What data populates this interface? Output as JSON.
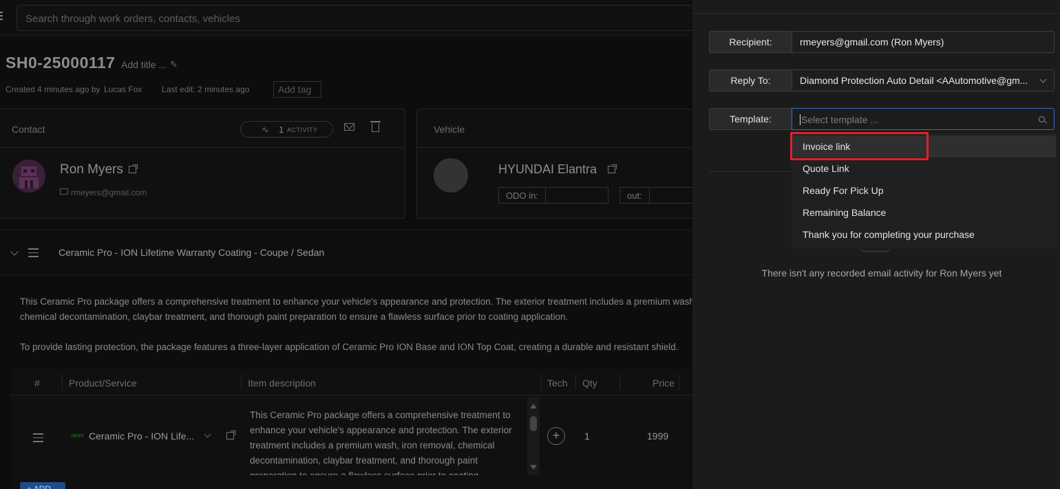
{
  "header": {
    "search_placeholder": "Search through work orders, contacts, vehicles"
  },
  "work_order": {
    "number": "SH0-25000117",
    "add_title": "Add title ...",
    "created": "Created 4 minutes ago by",
    "created_by": "Lucas Fox",
    "last_edit": "Last edit: 2 minutes ago",
    "add_tag": "Add tag"
  },
  "contact_card": {
    "title": "Contact",
    "activity_count": "1",
    "activity_label": "ACTIVITY",
    "name": "Ron Myers",
    "email": "rmeyers@gmail.com"
  },
  "vehicle_card": {
    "title": "Vehicle",
    "name": "HYUNDAI Elantra",
    "odo_in_label": "ODO in:",
    "odo_out_label": "out:"
  },
  "service": {
    "title": "Ceramic Pro - ION Lifetime Warranty Coating - Coupe / Sedan",
    "desc_line1": "This Ceramic Pro package offers a comprehensive treatment to enhance your vehicle's appearance and protection. The exterior treatment includes a premium wash, iron removal,",
    "desc_line2": "chemical decontamination, claybar treatment, and thorough paint preparation to ensure a flawless surface prior to coating application.",
    "desc_line3": "To provide lasting protection, the package features a three-layer application of Ceramic Pro ION Base and ION Top Coat, creating a durable and resistant shield."
  },
  "table": {
    "columns": [
      "#",
      "Product/Service",
      "Item description",
      "Tech",
      "Qty",
      "Price"
    ],
    "row": {
      "tag": "SERV",
      "product": "Ceramic Pro - ION Life...",
      "description": "This Ceramic Pro package offers a comprehensive treatment to enhance your vehicle's appearance and protection. The exterior treatment includes a premium wash, iron removal, chemical decontamination, claybar treatment, and thorough paint preparation to ensure a flawless surface prior to coating",
      "qty": "1",
      "price": "1999"
    },
    "add_button": "+ ADD"
  },
  "email_panel": {
    "recipient_label": "Recipient:",
    "recipient_value": "rmeyers@gmail.com (Ron Myers)",
    "reply_to_label": "Reply To:",
    "reply_to_value": "Diamond Protection Auto Detail <AAutomotive@gm...",
    "template_label": "Template:",
    "template_placeholder": "Select template ...",
    "templates": [
      "Invoice link",
      "Quote Link",
      "Ready For Pick Up",
      "Remaining Balance",
      "Thank you for completing your purchase"
    ],
    "empty_message": "There isn't any recorded email activity for Ron Myers yet"
  },
  "colors": {
    "highlight_box": "#e0202a",
    "focus_border": "#3a6fd0",
    "activity_green": "#3a9a3a"
  }
}
